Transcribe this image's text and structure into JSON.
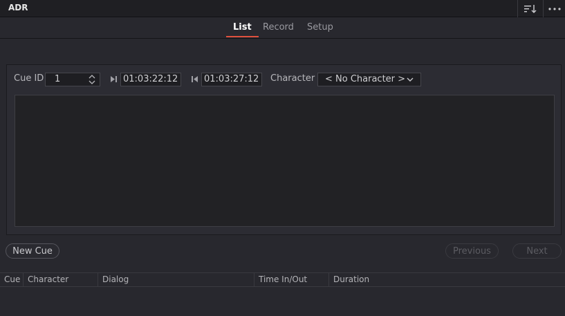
{
  "window": {
    "title": "ADR"
  },
  "toolbar": {
    "sort_icon": "sort-icon",
    "more_icon": "more-icon"
  },
  "tabs": [
    {
      "label": "List",
      "active": true
    },
    {
      "label": "Record",
      "active": false
    },
    {
      "label": "Setup",
      "active": false
    }
  ],
  "cue_editor": {
    "cue_id_label": "Cue ID",
    "cue_id_value": "1",
    "time_in": "01:03:22:12",
    "time_out": "01:03:27:12",
    "character_label": "Character",
    "character_value": "< No Character >",
    "dialog_text": ""
  },
  "actions": {
    "new_cue": "New Cue",
    "previous": "Previous",
    "next": "Next"
  },
  "table": {
    "columns": [
      "Cue",
      "Character",
      "Dialog",
      "Time In/Out",
      "Duration"
    ],
    "rows": []
  },
  "colors": {
    "accent": "#e0513e",
    "background": "#28282e"
  }
}
